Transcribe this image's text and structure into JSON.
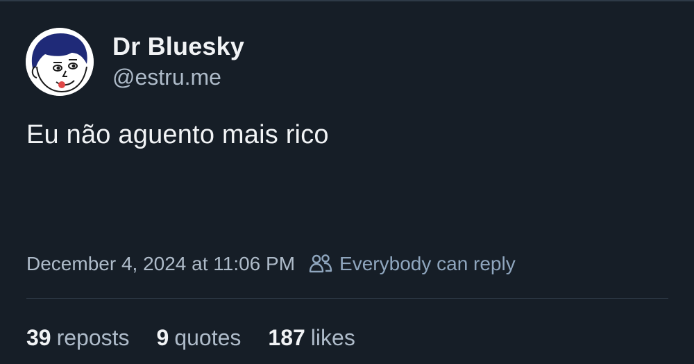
{
  "author": {
    "display_name": "Dr Bluesky",
    "handle": "@estru.me",
    "avatar": "cartoon-face-avatar"
  },
  "post": {
    "text": "Eu não aguento mais rico",
    "timestamp": "December 4, 2024 at 11:06 PM",
    "reply_setting": "Everybody can reply",
    "reply_icon": "people-icon"
  },
  "stats": {
    "reposts": {
      "count": "39",
      "label": "reposts"
    },
    "quotes": {
      "count": "9",
      "label": "quotes"
    },
    "likes": {
      "count": "187",
      "label": "likes"
    }
  },
  "colors": {
    "background": "#161e27",
    "primary_text": "#f1f3f5",
    "secondary_text": "#aebbc9",
    "divider": "#2e3a47"
  }
}
